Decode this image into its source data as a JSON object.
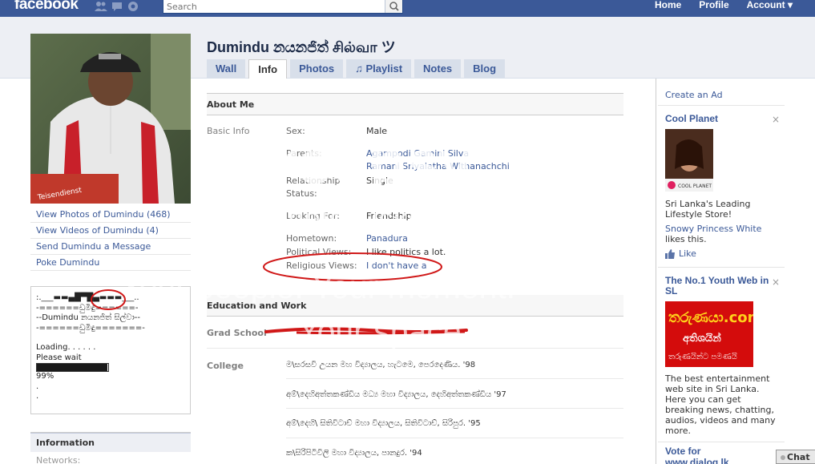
{
  "topbar": {
    "logo": "facebook",
    "search_placeholder": "Search",
    "nav": [
      "Home",
      "Profile",
      "Account ▾"
    ]
  },
  "profile": {
    "name": "Dumindu නයනජිත් சில்வா ツ",
    "tabs": [
      "Wall",
      "Info",
      "Photos",
      "♫ Playlist",
      "Notes",
      "Blog"
    ],
    "active_tab": "Info",
    "photo_sign": "Teisendienst",
    "left_links": [
      "View Photos of Dumindu (468)",
      "View Videos of Dumindu (4)",
      "Send Dumindu a Message",
      "Poke Dumindu"
    ]
  },
  "bio_box": {
    "lines": [
      ":.___▬▬▄█▀█▄▬▬▬___..",
      "-======ඩුමිඳු======-",
      "--Dumindu නයනජිත් සිල්වා--",
      "-======ඩුමිඳු=======-",
      "",
      "Loading. . . . . .",
      "Please wait",
      "",
      "99%",
      ".",
      "."
    ],
    "progress": 0.99
  },
  "information": {
    "heading": "Information",
    "sub": "Networks:"
  },
  "about": {
    "heading": "About Me",
    "basic_info_label": "Basic Info",
    "fields": {
      "sex_label": "Sex:",
      "sex": "Male",
      "parents_label": "Parents:",
      "parent1": "Agampodi Gamini Silva",
      "parent2": "Ramani Sriyalatha Withanachchi",
      "relationship_label1": "Relationship",
      "relationship_label2": "Status:",
      "relationship": "Single",
      "looking_label": "Looking For:",
      "looking": "Friendship",
      "hometown_label": "Hometown:",
      "hometown": "Panadura",
      "political_label": "Political Views:",
      "political": "I like politics a lot.",
      "religious_label": "Religious Views:",
      "religious": "I don't have a"
    }
  },
  "education": {
    "heading": "Education and Work",
    "grad_label": "Grad School",
    "college_label": "College",
    "colleges": [
      "ම\\සරසවි උයන මහ විද්‍යාලය, හැටමෙ, පෙරදෙණිය. '98",
      "අම්\\දෙහිඅත්තකණ්ඩිය මධ්‍ය මහා විද්‍යාලය, දෙහිඅත්තකණ්ඩිය '97",
      "අම්\\දෙහි\\ සිතිවිටාච් මහා විද්‍යාලය, සිතිවිටාච්, සිරිපුර. '95",
      "ක\\සිරිපිටිවිලි මහා විද්‍යාලය, පානදුර. '94"
    ]
  },
  "sidebar": {
    "create_ad": "Create an Ad",
    "ad1": {
      "title": "Cool Planet",
      "text": "Sri Lanka's Leading Lifestyle Store!",
      "liker": "Snowy Princess White",
      "likes_suffix": "likes this.",
      "like_label": "Like",
      "image_text": "COOL PLANET"
    },
    "ad2": {
      "title": "The No.1 Youth Web in SL",
      "image_line1": "තරුණයා.com",
      "image_line2": "අතිශයින්",
      "image_line3": "තරුණයින්ට පමණයි",
      "text": "The best entertainment web site in Sri Lanka. Here you can get breaking news, chatting, audios, videos and many more."
    },
    "ad3": {
      "title1": "Vote for",
      "title2": "www.dialog.lk"
    },
    "close_glyph": "×"
  },
  "watermark": {
    "brand": "Groupsy",
    "sub": "by photobucket",
    "line1": "Your people. Your moment.",
    "line2": "Your space."
  },
  "chat": "Chat",
  "colors": {
    "fb_blue": "#3b5998",
    "annotation_red": "#d01818"
  }
}
